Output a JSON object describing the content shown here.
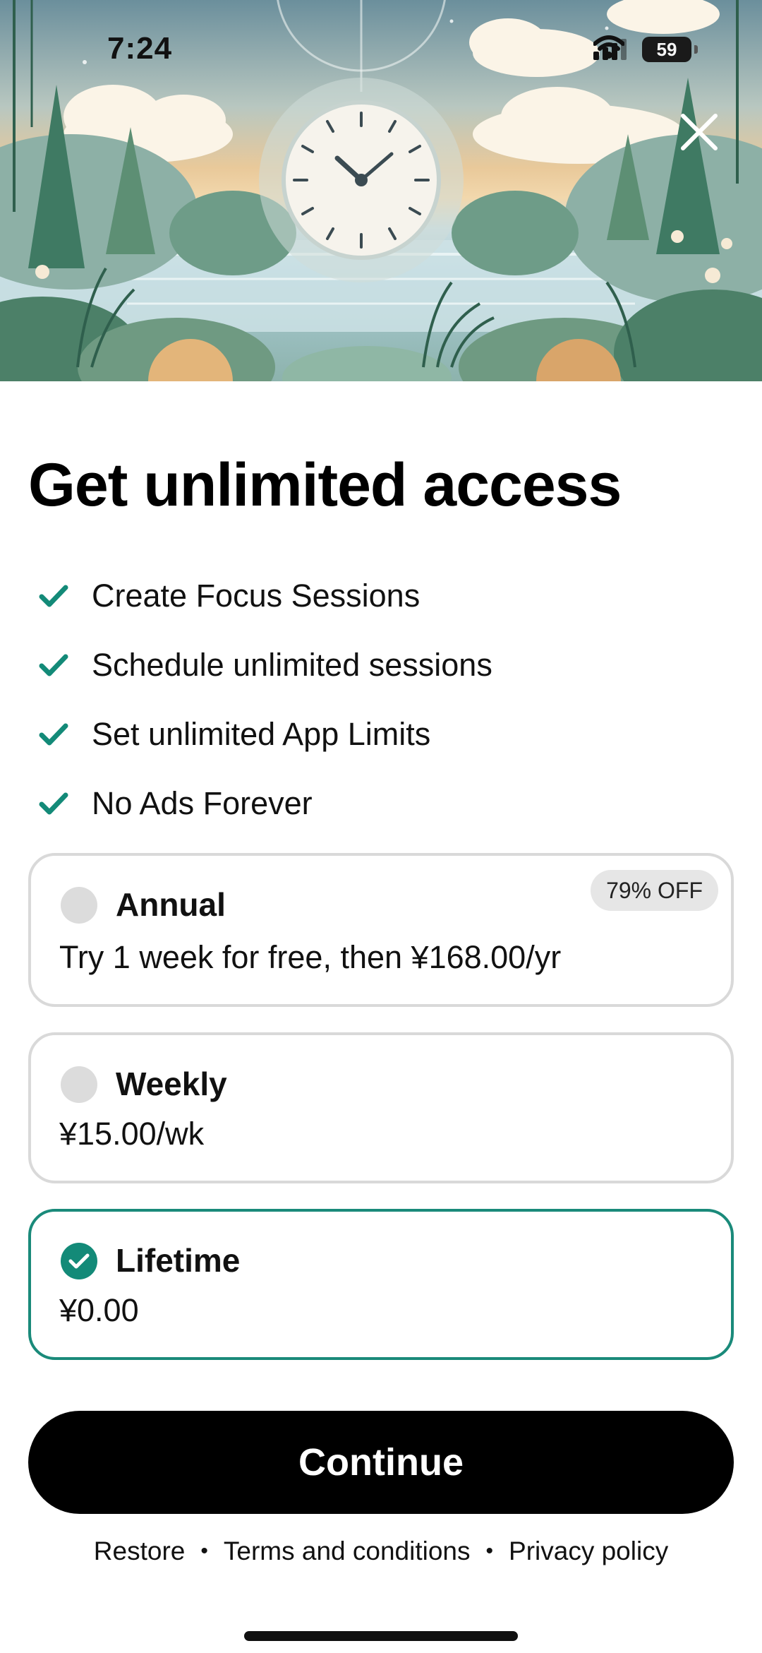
{
  "status_bar": {
    "time": "7:24",
    "battery_level": "59",
    "icons": [
      "cellular-signal-icon",
      "wifi-icon",
      "battery-icon"
    ]
  },
  "hero": {
    "icons": [
      "clock-icon",
      "close-icon"
    ]
  },
  "title": "Get unlimited access",
  "features": [
    "Create Focus Sessions",
    "Schedule unlimited sessions",
    "Set unlimited App Limits",
    "No Ads Forever"
  ],
  "plans": [
    {
      "name": "Annual",
      "price": "Try 1 week for free, then ¥168.00/yr",
      "badge": "79% OFF",
      "selected": false
    },
    {
      "name": "Weekly",
      "price": "¥15.00/wk",
      "selected": false
    },
    {
      "name": "Lifetime",
      "price": "¥0.00",
      "selected": true
    }
  ],
  "continue_label": "Continue",
  "footer_links": {
    "restore": "Restore",
    "terms": "Terms and conditions",
    "privacy": "Privacy policy",
    "separator": "•"
  },
  "colors": {
    "accent": "#138a78",
    "button": "#000000",
    "unselected_border": "#d9d9d9"
  }
}
